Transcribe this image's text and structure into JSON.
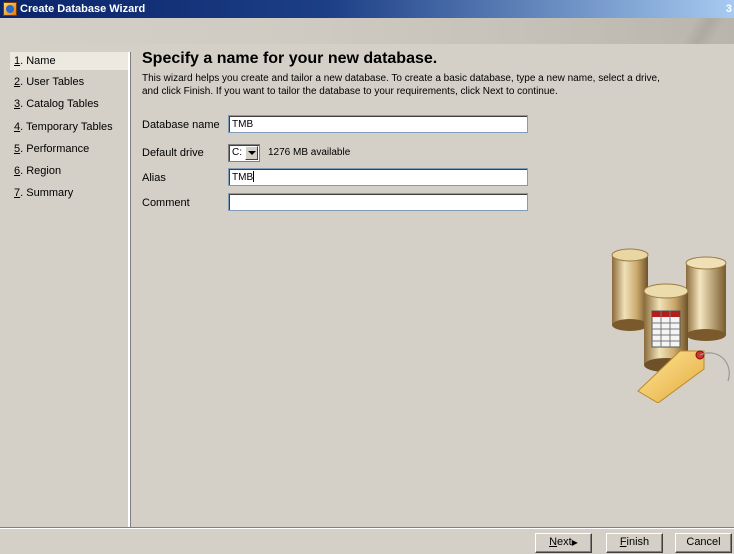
{
  "window": {
    "title": "Create Database Wizard",
    "title_extra": "3",
    "icon": "database-wizard-icon"
  },
  "sidebar": {
    "items": [
      {
        "num": "1",
        "label": ". Name",
        "selected": true
      },
      {
        "num": "2",
        "label": ". User Tables",
        "selected": false
      },
      {
        "num": "3",
        "label": ". Catalog Tables",
        "selected": false
      },
      {
        "num": "4",
        "label": ". Temporary Tables",
        "selected": false
      },
      {
        "num": "5",
        "label": ". Performance",
        "selected": false
      },
      {
        "num": "6",
        "label": ". Region",
        "selected": false
      },
      {
        "num": "7",
        "label": ". Summary",
        "selected": false
      }
    ]
  },
  "main": {
    "title": "Specify a name for your new database.",
    "description_line1": "This wizard helps you create and tailor a new database. To create a basic database, type a new name, select a drive,",
    "description_line2": "and click Finish. If you want to tailor the database to your requirements, click Next to continue.",
    "fields": {
      "database_name_label": "Database name",
      "database_name_value": "TMB",
      "default_drive_label": "Default drive",
      "default_drive_value": "C:",
      "drive_available": "1276 MB available",
      "alias_label": "Alias",
      "alias_value": "TMB",
      "comment_label": "Comment",
      "comment_value": ""
    },
    "illustration": "database-cylinders-with-tag-icon"
  },
  "buttons": {
    "next_u": "N",
    "next_rest": "ext",
    "next_arrow": "▶",
    "finish_u": "F",
    "finish_rest": "inish",
    "cancel": "Cancel"
  },
  "colors": {
    "titlebar_start": "#0a246a",
    "titlebar_end": "#a6caf0",
    "face": "#d4d0c8",
    "selected_item": "#ece9e0",
    "tag": "#f2c65a",
    "tag_pin": "#d8322a"
  }
}
